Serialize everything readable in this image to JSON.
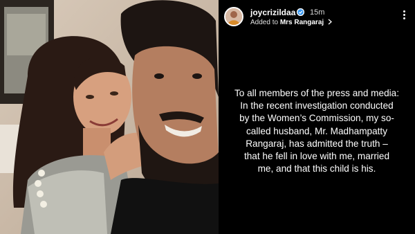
{
  "story": {
    "username": "joycrizildaa",
    "timestamp": "15m",
    "added_prefix": "Added to ",
    "added_target": "Mrs Rangaraj",
    "chevron": "chevron-right-icon",
    "verified_icon": "verified-badge-icon",
    "more_icon": "more-vertical-icon"
  },
  "caption": {
    "lines": [
      "To all members of the press and media:",
      "In the recent investigation conducted",
      "by the Women’s Commission, my so-",
      "called husband, Mr. Madhampatty",
      "Rangaraj, has admitted the truth –",
      "that he fell in love with me, married",
      "me, and that this child is his."
    ]
  },
  "colors": {
    "story_background": "#000000",
    "text": "#ffffff",
    "verified_blue": "#3897f0"
  }
}
